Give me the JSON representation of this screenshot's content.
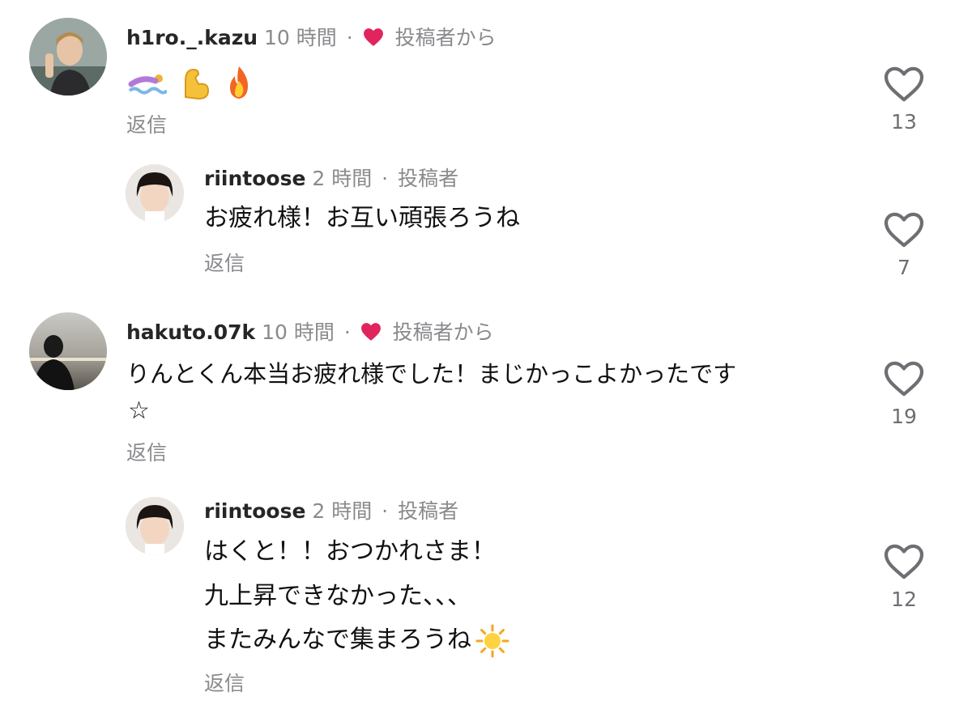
{
  "comments": [
    {
      "username": "h1ro._.kazu",
      "time": "10 時間",
      "separator": "·",
      "author_tag": "投稿者から",
      "author_heart": true,
      "emojis": [
        "swimmer-emoji",
        "flexed-biceps-emoji",
        "fire-emoji"
      ],
      "reply_label": "返信",
      "likes": "13"
    },
    {
      "username": "riintoose",
      "time": "2 時間",
      "separator": "·",
      "author_tag": "投稿者",
      "lines": [
        "お疲れ様！お互い頑張ろうね"
      ],
      "reply_label": "返信",
      "likes": "7"
    },
    {
      "username": "hakuto.07k",
      "time": "10 時間",
      "separator": "·",
      "author_tag": "投稿者から",
      "author_heart": true,
      "lines": [
        "りんとくん本当お疲れ様でした！まじかっこよかったです",
        "☆"
      ],
      "reply_label": "返信",
      "likes": "19"
    },
    {
      "username": "riintoose",
      "time": "2 時間",
      "separator": "·",
      "author_tag": "投稿者",
      "lines": [
        "はくと！！おつかれさま！",
        "九上昇できなかった、、、",
        "またみんなで集まろうね"
      ],
      "trailing_emoji": "sun-emoji",
      "reply_label": "返信",
      "likes": "12"
    }
  ],
  "colors": {
    "heart": "#e0245e",
    "meta": "#8a8a8e",
    "icon": "#6e6e73"
  }
}
